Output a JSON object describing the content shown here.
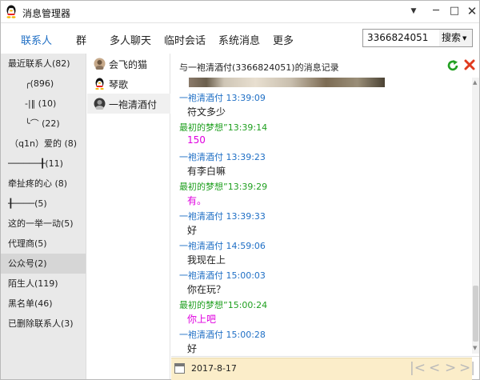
{
  "window": {
    "title": "消息管理器",
    "dropdown_glyph": "▼",
    "minimize_glyph": "─",
    "maximize_glyph": "□",
    "close_glyph": "✕"
  },
  "tabs": [
    "联系人",
    "群",
    "多人聊天",
    "临时会话",
    "系统消息",
    "更多"
  ],
  "active_tab": "联系人",
  "search": {
    "value": "3366824051",
    "button_label": "搜索",
    "arrow_glyph": "▼"
  },
  "sidebar": {
    "items": [
      {
        "label": "最近联系人(82)"
      },
      {
        "label": "╭(896)"
      },
      {
        "label": "-|‖     (10)"
      },
      {
        "label": "╰⌒     (22)"
      },
      {
        "label": "（q1n）爱的 (8)"
      },
      {
        "label": "──────╂(11)"
      },
      {
        "label": "牵扯疼的心  (8)"
      },
      {
        "label": "╂────(5)"
      },
      {
        "label": "这的一举一动(5)"
      },
      {
        "label": "代理商(5)"
      },
      {
        "label": "公众号(2)"
      },
      {
        "label": "陌生人(119)"
      },
      {
        "label": "黑名单(46)"
      },
      {
        "label": "已删除联系人(3)"
      }
    ],
    "selected_index": 10
  },
  "contacts": [
    {
      "name": "会飞的猫",
      "icon": "avatar-photo-icon"
    },
    {
      "name": "琴歌",
      "icon": "qq-penguin-icon"
    },
    {
      "name": "一袍清酒付",
      "icon": "avatar-photo-icon"
    }
  ],
  "chat": {
    "title": "与一袍清酒付(3366824051)的消息记录",
    "refresh_icon": "refresh-icon",
    "delete_icon": "delete-icon",
    "messages": [
      {
        "sender": "一袍清酒付",
        "time": "13:39:09",
        "text": "符文多少",
        "me": false
      },
      {
        "sender": "最初的梦想”",
        "time": "13:39:14",
        "text": "150",
        "me": true
      },
      {
        "sender": "一袍清酒付",
        "time": "13:39:23",
        "text": "有李白嘛",
        "me": false
      },
      {
        "sender": "最初的梦想”",
        "time": "13:39:29",
        "text": "有。",
        "me": true
      },
      {
        "sender": "一袍清酒付",
        "time": "13:39:33",
        "text": "好",
        "me": false
      },
      {
        "sender": "一袍清酒付",
        "time": "14:59:06",
        "text": "我现在上",
        "me": false
      },
      {
        "sender": "一袍清酒付",
        "time": "15:00:03",
        "text": "你在玩？",
        "me": false
      },
      {
        "sender": "最初的梦想”",
        "time": "15:00:24",
        "text": "你上吧",
        "me": true
      },
      {
        "sender": "一袍清酒付",
        "time": "15:00:28",
        "text": "好",
        "me": false
      }
    ],
    "colors": {
      "peer": "#1f6fc5",
      "me": "#20a020",
      "my_text": "#e000e0",
      "highlight": "#fbedc9"
    }
  },
  "footer": {
    "date": "2017-8-17",
    "calendar_icon": "calendar-icon",
    "nav": [
      "|<",
      "<",
      ">",
      ">|"
    ]
  }
}
